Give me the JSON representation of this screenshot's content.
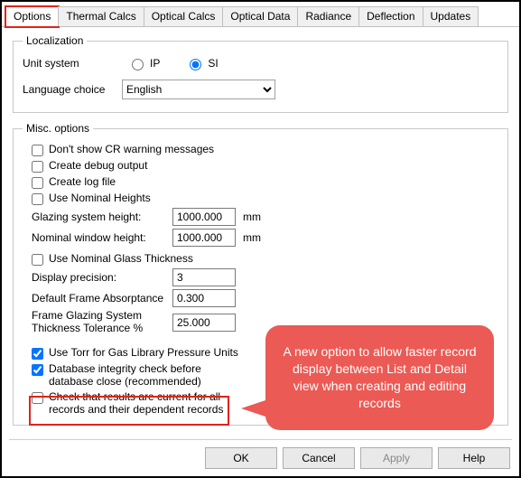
{
  "tabs": {
    "options": "Options",
    "thermal": "Thermal Calcs",
    "optical_calcs": "Optical Calcs",
    "optical_data": "Optical Data",
    "radiance": "Radiance",
    "deflection": "Deflection",
    "updates": "Updates"
  },
  "localization": {
    "legend": "Localization",
    "unit_system_label": "Unit system",
    "ip": "IP",
    "si": "SI",
    "language_label": "Language choice",
    "language_value": "English"
  },
  "misc": {
    "legend": "Misc. options",
    "cr_warn": "Don't show CR warning messages",
    "debug": "Create debug output",
    "logfile": "Create log file",
    "nominal_heights": "Use Nominal Heights",
    "glz_height_label": "Glazing system height:",
    "glz_height_value": "1000.000",
    "glz_height_unit": "mm",
    "nom_win_label": "Nominal window height:",
    "nom_win_value": "1000.000",
    "nom_win_unit": "mm",
    "nominal_glass": "Use Nominal Glass Thickness",
    "disp_prec_label": "Display precision:",
    "disp_prec_value": "3",
    "abs_label": "Default Frame Absorptance",
    "abs_value": "0.300",
    "tol_label": "Frame Glazing System\nThickness Tolerance %",
    "tol_value": "25.000",
    "torr": "Use Torr for Gas Library Pressure Units",
    "integrity": "Database integrity check before database close (recommended)",
    "check_results": "Check that results are current for all records and their dependent records"
  },
  "callout": "A new option to allow faster record display between List and Detail view when creating and editing records",
  "buttons": {
    "ok": "OK",
    "cancel": "Cancel",
    "apply": "Apply",
    "help": "Help"
  }
}
